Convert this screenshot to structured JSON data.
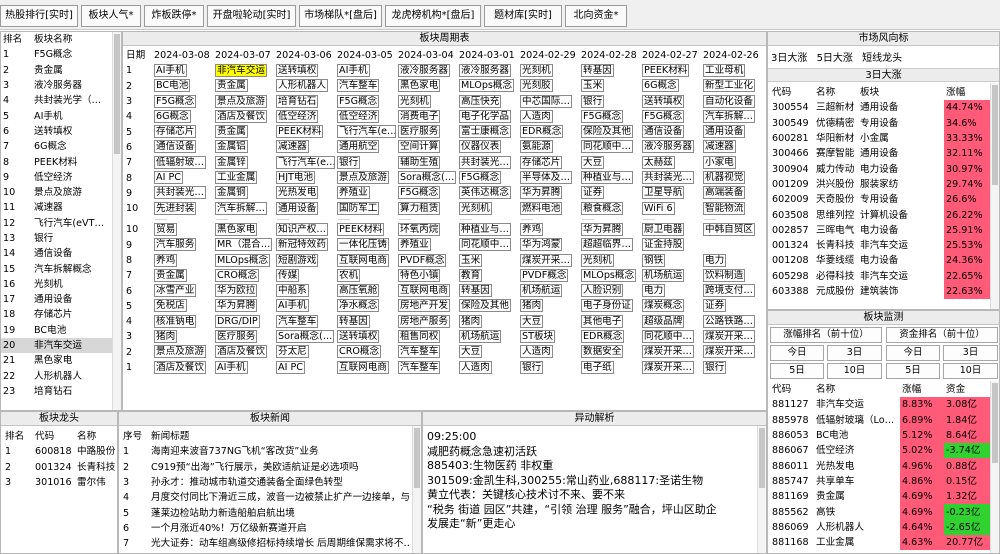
{
  "tabs": [
    "热股排行[实时]",
    "板块人气*",
    "炸板跌停*",
    "开盘啦轮动[实时]",
    "市场梯队*[盘后]",
    "龙虎榜机构*[盘后]",
    "题材库[实时]",
    "北向资金*"
  ],
  "rank": {
    "headers": [
      "排名",
      "板块名称"
    ],
    "rows": [
      [
        "1",
        "F5G概念"
      ],
      [
        "2",
        "贵金属"
      ],
      [
        "3",
        "液冷服务器"
      ],
      [
        "4",
        "共封装光学（…"
      ],
      [
        "5",
        "AI手机"
      ],
      [
        "6",
        "送转填权"
      ],
      [
        "7",
        "6G概念"
      ],
      [
        "8",
        "PEEK材料"
      ],
      [
        "9",
        "低空经济"
      ],
      [
        "10",
        "景点及旅游"
      ],
      [
        "11",
        "减速器"
      ],
      [
        "12",
        "飞行汽车(eVT…"
      ],
      [
        "13",
        "银行"
      ],
      [
        "14",
        "通信设备"
      ],
      [
        "15",
        "汽车拆解概念"
      ],
      [
        "16",
        "光刻机"
      ],
      [
        "17",
        "通用设备"
      ],
      [
        "18",
        "存储芯片"
      ],
      [
        "19",
        "BC电池"
      ],
      [
        "20",
        "非汽车交运"
      ],
      [
        "21",
        "黑色家电"
      ],
      [
        "22",
        "人形机器人"
      ],
      [
        "23",
        "培育钻石"
      ]
    ]
  },
  "cycle": {
    "title": "板块周期表",
    "date_label": "日期",
    "dates": [
      "2024-03-08",
      "2024-03-07",
      "2024-03-06",
      "2024-03-05",
      "2024-03-04",
      "2024-03-01",
      "2024-02-29",
      "2024-02-28",
      "2024-02-27",
      "2024-02-26"
    ],
    "top_rows": [
      [
        "1",
        "AI手机",
        "非汽车交运",
        "送转填权",
        "AI手机",
        "液冷服务器",
        "液冷服务器",
        "光刻机",
        "转基因",
        "PEEK材料",
        "工业母机"
      ],
      [
        "2",
        "BC电池",
        "贵金属",
        "人形机器人",
        "汽车整车",
        "黑色家电",
        "MLOps概念",
        "光刻胶",
        "玉米",
        "6G概念",
        "新型工业化"
      ],
      [
        "3",
        "F5G概念",
        "景点及旅游",
        "培育钻石",
        "F5G概念",
        "光刻机",
        "高压快充",
        "中芯国际…",
        "银行",
        "送转填权",
        "自动化设备"
      ],
      [
        "4",
        "6G概念",
        "酒店及餐饮",
        "低空经济",
        "低空经济",
        "消费电子",
        "电子化学品",
        "人造肉",
        "F5G概念",
        "F5G概念",
        "汽车拆解…"
      ],
      [
        "5",
        "存储芯片",
        "贵金属",
        "PEEK材料",
        "飞行汽车(e…",
        "医疗服务",
        "富士康概念",
        "EDR概念",
        "保险及其他",
        "通信设备",
        "通用设备"
      ],
      [
        "6",
        "通信设备",
        "金属铝",
        "减速器",
        "通用航空",
        "空间计算",
        "仪器仪表",
        "氨能源",
        "同花顺中…",
        "液冷服务器",
        "减速器"
      ],
      [
        "7",
        "低辐射玻…",
        "金属锌",
        "飞行汽车(e…",
        "银行",
        "辅助生殖",
        "共封装光…",
        "存储芯片",
        "大豆",
        "太赫兹",
        "小家电"
      ],
      [
        "8",
        "AI PC",
        "工业金属",
        "HJT电池",
        "景点及旅游",
        "Sora概念(…",
        "F5G概念",
        "半导体及…",
        "种植业与…",
        "共封装光…",
        "机器视觉"
      ],
      [
        "9",
        "共封装光…",
        "金属铜",
        "光热发电",
        "养殖业",
        "F5G概念",
        "英伟达概念",
        "华为昇腾",
        "证券",
        "卫星导航",
        "高端装备"
      ],
      [
        "10",
        "先进封装",
        "汽车拆解…",
        "通用设备",
        "国防军工",
        "算力租赁",
        "光刻机",
        "燃料电池",
        "粮食概念",
        "WiFi 6",
        "智能物流"
      ]
    ],
    "sep": [
      "……",
      "……",
      "……",
      "……",
      "……",
      "……",
      "……",
      "……",
      "……",
      "……"
    ],
    "bottom_rows": [
      [
        "10",
        "贸易",
        "黑色家电",
        "知识产权…",
        "PEEK材料",
        "环氧丙烷",
        "种植业与…",
        "养鸡",
        "华为昇腾",
        "厨卫电器",
        "中韩自贸区"
      ],
      [
        "9",
        "汽车服务",
        "MR（混合…",
        "新冠特效药",
        "一体化压铸",
        "养殖业",
        "同花顺中…",
        "华为鸿蒙",
        "超超临界…",
        "证金持股"
      ],
      [
        "8",
        "养鸡",
        "MLOps概念",
        "短剧游戏",
        "互联网电商",
        "PVDF概念",
        "玉米",
        "煤炭开采…",
        "光刻机",
        "钢铁",
        "电力"
      ],
      [
        "7",
        "贵金属",
        "CRO概念",
        "传媒",
        "农机",
        "特色小镇",
        "教育",
        "PVDF概念",
        "MLOps概念",
        "机场航运",
        "饮料制造"
      ],
      [
        "6",
        "冰雪产业",
        "华为欧拉",
        "中船系",
        "高压氧舱",
        "互联网电商",
        "转基因",
        "机场航运",
        "人脸识别",
        "电力",
        "跨境支付…"
      ],
      [
        "5",
        "免税店",
        "华为昇腾",
        "AI手机",
        "净水概念",
        "房地产开发",
        "保险及其他",
        "猪肉",
        "电子身份证",
        "煤炭概念",
        "证券"
      ],
      [
        "4",
        "核准钠电",
        "DRG/DIP",
        "汽车整车",
        "转基因",
        "房地产服务",
        "猪肉",
        "大豆",
        "其他电子",
        "超级品牌",
        "公路铁路…"
      ],
      [
        "3",
        "猪肉",
        "医疗服务",
        "Sora概念(…",
        "送转填权",
        "租售同权",
        "机场航运",
        "ST板块",
        "EDR概念",
        "同花顺中…",
        "煤炭开采…"
      ],
      [
        "2",
        "景点及旅游",
        "酒店及餐饮",
        "芬太尼",
        "CRO概念",
        "汽车整车",
        "大豆",
        "人造肉",
        "数据安全",
        "煤炭开采…",
        "煤炭开采…"
      ],
      [
        "1",
        "酒店及餐饮",
        "AI手机",
        "AI PC",
        "互联网电商",
        "汽车整车",
        "人造肉",
        "银行",
        "电子纸",
        "煤炭开采…",
        "银行"
      ]
    ]
  },
  "market_wind": {
    "title": "市场风向标",
    "tabs": [
      "3日大涨",
      "5日大涨",
      "短线龙头"
    ],
    "subtitle": "3日大涨",
    "headers": [
      "代码",
      "名称",
      "板块",
      "涨幅"
    ],
    "rows": [
      [
        "300554",
        "三超新材",
        "通用设备",
        "44.74%"
      ],
      [
        "300549",
        "优德精密",
        "专用设备",
        "34.6%"
      ],
      [
        "600281",
        "华阳新材",
        "小金属",
        "33.33%"
      ],
      [
        "300466",
        "赛摩智能",
        "通用设备",
        "32.11%"
      ],
      [
        "300904",
        "威力传动",
        "电力设备",
        "30.97%"
      ],
      [
        "001209",
        "洪兴股份",
        "服装家纺",
        "29.74%"
      ],
      [
        "602009",
        "天奇股份",
        "专用设备",
        "26.6%"
      ],
      [
        "603508",
        "思维列控",
        "计算机设备",
        "26.22%"
      ],
      [
        "002857",
        "三晖电气",
        "电力设备",
        "25.91%"
      ],
      [
        "001324",
        "长青科技",
        "非汽车交运",
        "25.53%"
      ],
      [
        "001208",
        "华菱线缆",
        "电力设备",
        "24.36%"
      ],
      [
        "605298",
        "必得科技",
        "非汽车交运",
        "22.65%"
      ],
      [
        "603388",
        "元成股份",
        "建筑装饰",
        "22.63%"
      ]
    ]
  },
  "sector_monitor": {
    "title": "板块监测",
    "left_btn": "涨幅排名（前十位）",
    "right_btn": "资金排名（前十位）",
    "periods_row1": [
      "今日",
      "3日",
      "今日",
      "3日"
    ],
    "periods_row2": [
      "5日",
      "10日",
      "5日",
      "10日"
    ],
    "headers": [
      "代码",
      "名称",
      "涨幅",
      "资金"
    ],
    "rows": [
      [
        "881127",
        "非汽车交运",
        "8.83%",
        "3.08亿"
      ],
      [
        "885978",
        "低辐射玻璃（Lo…",
        "6.89%",
        "1.84亿"
      ],
      [
        "886053",
        "BC电池",
        "5.12%",
        "8.64亿"
      ],
      [
        "886067",
        "低空经济",
        "5.02%",
        "-3.74亿"
      ],
      [
        "886011",
        "光热发电",
        "4.96%",
        "0.88亿"
      ],
      [
        "885747",
        "共享单车",
        "4.86%",
        "0.15亿"
      ],
      [
        "881169",
        "贵金属",
        "4.69%",
        "1.32亿"
      ],
      [
        "885562",
        "高铁",
        "4.69%",
        "-0.23亿"
      ],
      [
        "886069",
        "人形机器人",
        "4.64%",
        "-2.65亿"
      ],
      [
        "881168",
        "工业金属",
        "4.63%",
        "20.77亿"
      ]
    ]
  },
  "leader": {
    "title": "板块龙头",
    "headers": [
      "排名",
      "代码",
      "名称"
    ],
    "rows": [
      [
        "1",
        "600818",
        "中路股份"
      ],
      [
        "2",
        "001324",
        "长青科技"
      ],
      [
        "3",
        "301016",
        "雷尔伟"
      ]
    ]
  },
  "news": {
    "title": "板块新闻",
    "headers": [
      "序号",
      "新闻标题"
    ],
    "rows": [
      [
        "1",
        "海南迎来波音737NG飞机“客改货”业务"
      ],
      [
        "2",
        "C919预“出海”飞行展示，美欧适航证是必选项吗"
      ],
      [
        "3",
        "孙永才：推动城市轨道交通装备全面绿色转型"
      ],
      [
        "4",
        "月度交付同比下滑近三成，波音一边被禁止扩产一边接单，与…"
      ],
      [
        "5",
        "蓬莱边检站助力新造船舶启航出境"
      ],
      [
        "6",
        "一个月涨近40%！万亿级新赛道开启"
      ],
      [
        "7",
        "光大证券：动车组高级修招标持续增长 后周期维保需求将不…"
      ]
    ]
  },
  "analysis": {
    "title": "异动解析",
    "lines": [
      "09:25:00",
      "减肥药概念急速初活跃",
      "885403:生物医药 非权重",
      "301509:金凯生科,300255:常山药业,688117:圣诺生物",
      "黄立代表：关键核心技术讨不来、要不来",
      "“税务 街道 园区”共建，“引领 治理 服务”融合，坪山区助企",
      "发展走“新”更走心"
    ]
  },
  "colors": {
    "highlight": "#ffff00",
    "up": "#f03a5a",
    "down": "#2fd22f",
    "selected_row": "#d7d7d7"
  }
}
